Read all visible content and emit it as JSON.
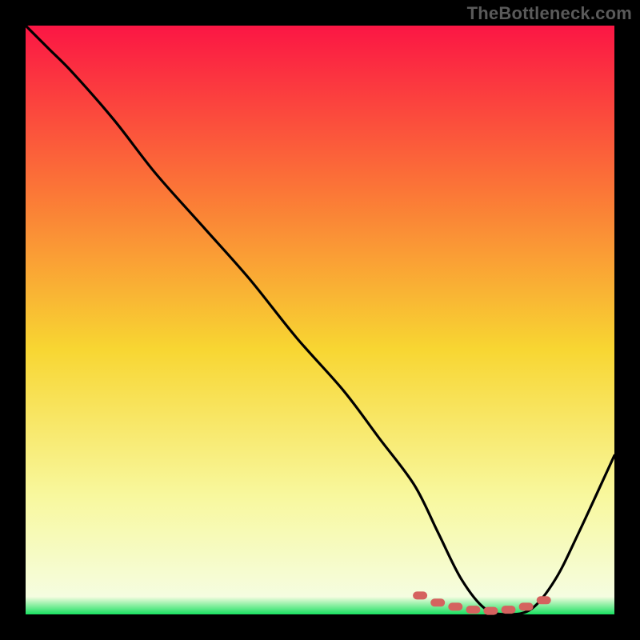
{
  "watermark": "TheBottleneck.com",
  "colors": {
    "bg": "#000000",
    "grad_top": "#fb1644",
    "grad_mid_upper": "#fb7637",
    "grad_mid": "#f8d632",
    "grad_lower": "#f8f89e",
    "grad_bottom": "#18e060",
    "curve": "#000000",
    "marker": "#d5625f"
  },
  "chart_data": {
    "type": "line",
    "title": "",
    "xlabel": "",
    "ylabel": "",
    "xlim": [
      0,
      100
    ],
    "ylim": [
      0,
      100
    ],
    "series": [
      {
        "name": "bottleneck-curve",
        "x": [
          0,
          4,
          8,
          15,
          22,
          30,
          38,
          46,
          54,
          60,
          66,
          70,
          74,
          78,
          82,
          86,
          90,
          94,
          100
        ],
        "values": [
          100,
          96,
          92,
          84,
          75,
          66,
          57,
          47,
          38,
          30,
          22,
          14,
          6,
          1,
          0,
          1,
          6,
          14,
          27
        ]
      }
    ],
    "markers": {
      "name": "optimal-range",
      "x": [
        67,
        70,
        73,
        76,
        79,
        82,
        85,
        88
      ],
      "y": [
        3.2,
        2.0,
        1.3,
        0.8,
        0.6,
        0.8,
        1.3,
        2.4
      ]
    }
  }
}
